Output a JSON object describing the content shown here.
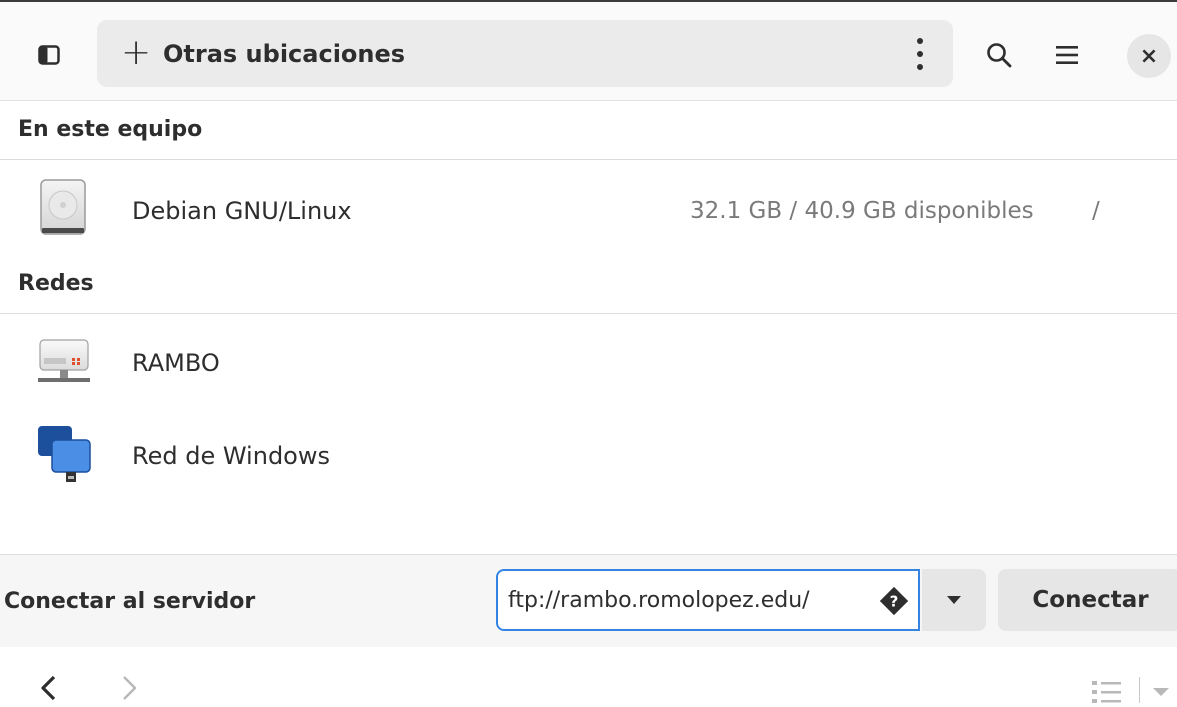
{
  "header": {
    "location_label": "Otras ubicaciones",
    "close_glyph": "×"
  },
  "sections": {
    "local": {
      "title": "En este equipo",
      "items": [
        {
          "name": "Debian GNU/Linux",
          "info": "32.1 GB / 40.9 GB disponibles",
          "mount": "/",
          "icon": "hard-drive-icon"
        }
      ]
    },
    "network": {
      "title": "Redes",
      "items": [
        {
          "name": "RAMBO",
          "icon": "network-server-icon"
        },
        {
          "name": "Red de Windows",
          "icon": "windows-network-icon"
        }
      ]
    }
  },
  "connect": {
    "label": "Conectar al servidor",
    "input_value": "ftp://rambo.romolopez.edu/",
    "button_label": "Conectar"
  },
  "colors": {
    "accent": "#3584e4",
    "background": "#ffffff",
    "header_bg": "#fafafa",
    "button_bg": "#e6e6e6"
  }
}
